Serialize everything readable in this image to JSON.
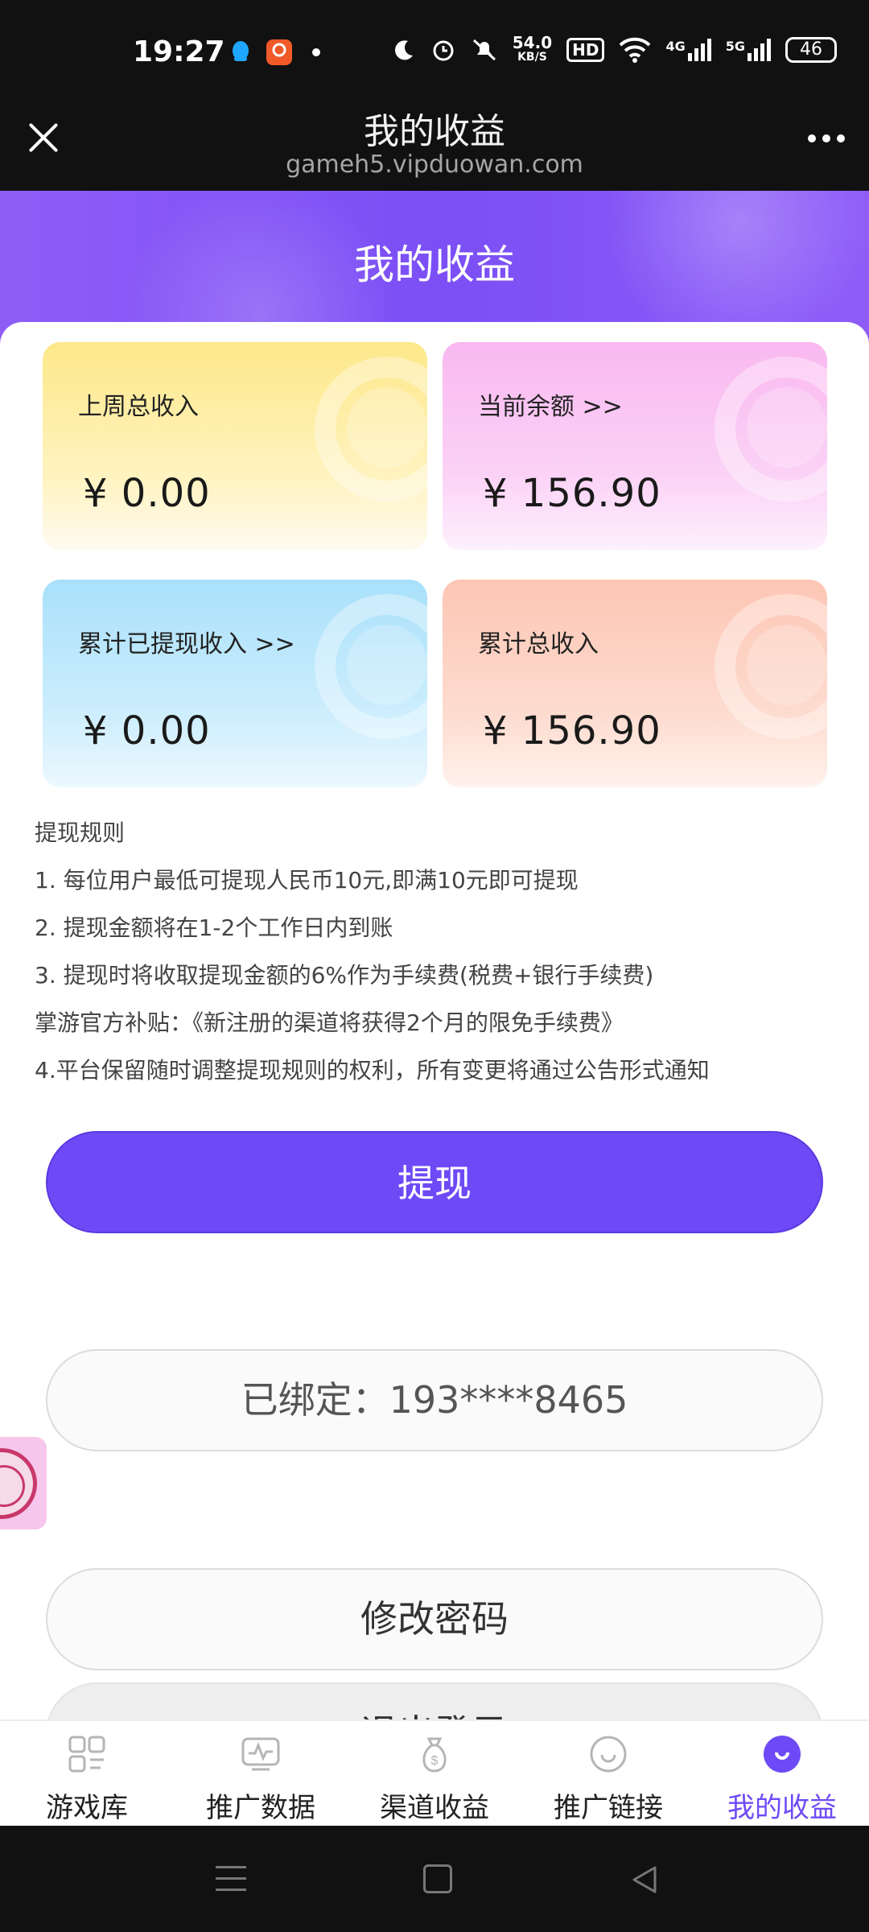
{
  "status_bar": {
    "time": "19:27",
    "net_speed_value": "54.0",
    "net_speed_unit": "KB/S",
    "hd_label": "HD",
    "signal_4g": "4G",
    "signal_5g": "5G",
    "battery": "46",
    "icons": [
      "qq-icon",
      "app-icon",
      "moon-icon",
      "alarm-icon",
      "mute-icon",
      "wifi-icon",
      "signal-icon"
    ]
  },
  "browser": {
    "title": "我的收益",
    "url": "gameh5.vipduowan.com"
  },
  "header": {
    "title": "我的收益"
  },
  "cards": [
    {
      "label": "上周总收入",
      "value": "¥ 0.00"
    },
    {
      "label": "当前余额 >>",
      "value": "¥ 156.90"
    },
    {
      "label": "累计已提现收入 >>",
      "value": "¥ 0.00"
    },
    {
      "label": "累计总收入",
      "value": "¥ 156.90"
    }
  ],
  "rules": {
    "title": "提现规则",
    "items": [
      "1. 每位用户最低可提现人民币10元,即满10元即可提现",
      "2. 提现金额将在1-2个工作日内到账",
      "3. 提现时将收取提现金额的6%作为手续费(税费+银行手续费)",
      "掌游官方补贴：《新注册的渠道将获得2个月的限免手续费》",
      "4.平台保留随时调整提现规则的权利，所有变更将通过公告形式通知"
    ]
  },
  "buttons": {
    "withdraw": "提现",
    "bound": "已绑定：193****8465",
    "change_password": "修改密码",
    "logout": "退出登录"
  },
  "tabs": [
    {
      "label": "游戏库",
      "icon": "grid-icon"
    },
    {
      "label": "推广数据",
      "icon": "chart-icon"
    },
    {
      "label": "渠道收益",
      "icon": "money-bag-icon"
    },
    {
      "label": "推广链接",
      "icon": "smile-icon"
    },
    {
      "label": "我的收益",
      "icon": "profile-icon",
      "active": true
    }
  ],
  "colors": {
    "accent": "#6d4af6",
    "header_purple": "#7b4ff5"
  }
}
